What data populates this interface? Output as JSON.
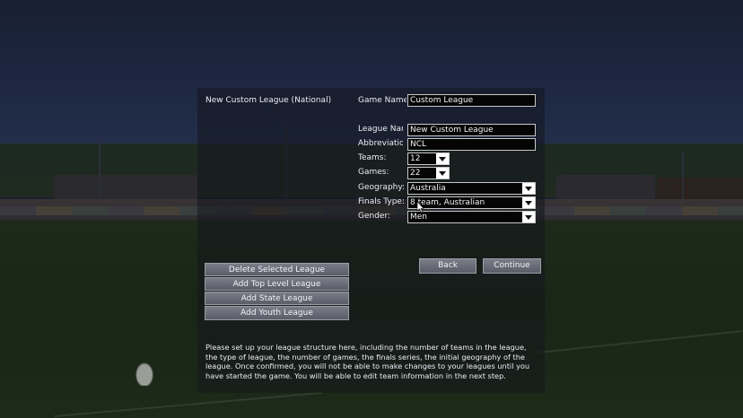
{
  "league_header": "New Custom League (National)",
  "form": {
    "game_name_label": "Game Name:",
    "game_name_value": "Custom League",
    "league_name_label": "League Name",
    "league_name_value": "New Custom League",
    "abbreviation_label": "Abbreviation",
    "abbreviation_value": "NCL",
    "teams_label": "Teams:",
    "teams_value": "12",
    "games_label": "Games:",
    "games_value": "22",
    "geography_label": "Geography:",
    "geography_value": "Australia",
    "finals_type_label": "Finals Type:",
    "finals_type_value": "8 team, Australian",
    "gender_label": "Gender:",
    "gender_value": "Men"
  },
  "actions": {
    "back": "Back",
    "continue": "Continue"
  },
  "league_buttons": [
    "Delete Selected League",
    "Add Top Level League",
    "Add State League",
    "Add Youth League"
  ],
  "help_text": "Please set up your league structure here, including the number of teams in the league, the type of league, the number of games, the finals series, the initial geography of the league. Once confirmed, you will not be able to make changes to your leagues until you have started the game. You will be able to edit team information in the next step.",
  "icons": {
    "dropdown": "chevron-down-icon",
    "cursor": "mouse-pointer-icon"
  }
}
